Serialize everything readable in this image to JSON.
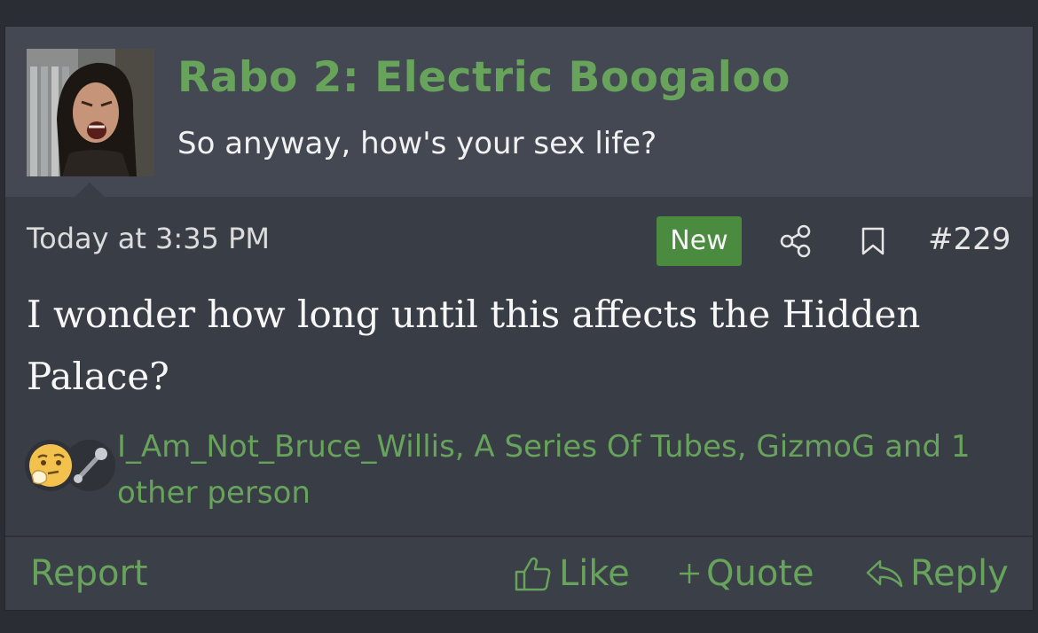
{
  "author": {
    "name": "Rabo 2: Electric Boogaloo",
    "title": "So anyway, how's your sex life?",
    "avatar_icon": "user-avatar-photo"
  },
  "post": {
    "date": "Today at 3:35 PM",
    "badge": "New",
    "number": "#229",
    "body": "I wonder how long until this affects the Hidden Palace?",
    "share_icon": "share-icon",
    "bookmark_icon": "bookmark-icon"
  },
  "reactions": {
    "icons": [
      "thinking-face-icon",
      "wrench-icon"
    ],
    "text": "I_Am_Not_Bruce_Willis, A Series Of Tubes, GizmoG and 1 other person"
  },
  "footer": {
    "report": "Report",
    "like": "Like",
    "quote": "Quote",
    "reply": "Reply"
  },
  "colors": {
    "accent": "#67a35b",
    "badge": "#4b8b3f",
    "panel": "#393d46",
    "header": "#434852",
    "background": "#2a2d33"
  }
}
